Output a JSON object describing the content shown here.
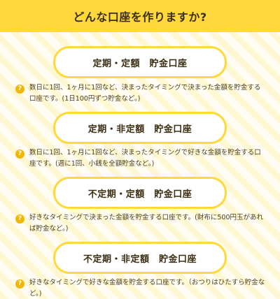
{
  "header": {
    "title": "どんな口座を作りますか?"
  },
  "options": [
    {
      "label": "定期・定額　貯金口座",
      "description": "数日に1回、1ヶ月に1回など、決まったタイミングで決まった金額を貯金する口座です。(1日100円ずつ貯金など。)"
    },
    {
      "label": "定期・非定額　貯金口座",
      "description": "数日に1回、1ヶ月に1回など、決まったタイミングで好きな金額を貯金する口座です。(週に1回、小銭を全額貯金など。)"
    },
    {
      "label": "不定期・定額　貯金口座",
      "description": "好きなタイミングで決まった金額を貯金する口座です。(財布に500円玉があれば貯金など。)"
    },
    {
      "label": "不定期・非定額　貯金口座",
      "description": "好きなタイミングで好きな金額を貯金する口座です。（おつりはひたすら貯金など。)"
    }
  ],
  "icons": {
    "help": "question-mark-circle-icon"
  },
  "colors": {
    "accent": "#ffd93b",
    "icon": "#f2b705",
    "text": "#3b2e12"
  }
}
